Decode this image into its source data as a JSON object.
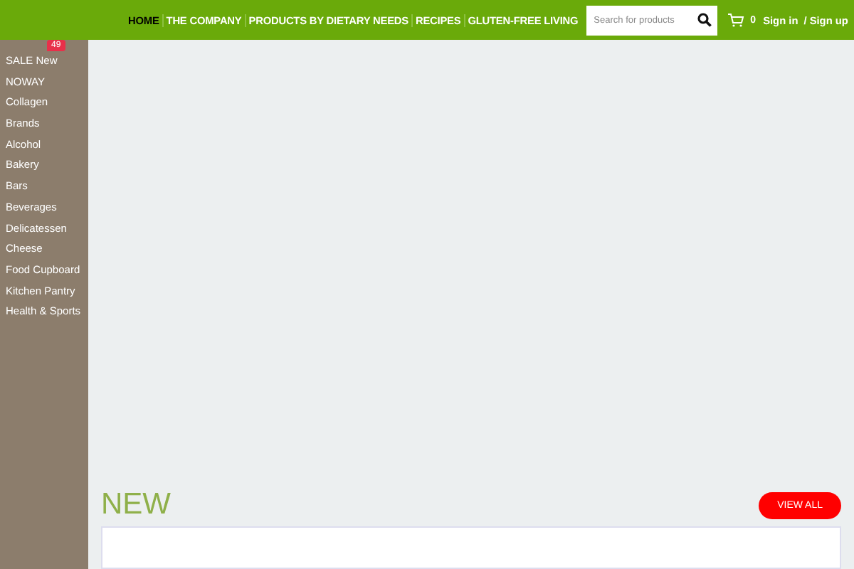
{
  "nav": [
    {
      "label": "HOME",
      "selected": true
    },
    {
      "label": "THE COMPANY",
      "selected": false
    },
    {
      "label": "PRODUCTS BY DIETARY NEEDS",
      "selected": false
    },
    {
      "label": "RECIPES",
      "selected": false
    },
    {
      "label": "GLUTEN-FREE LIVING",
      "selected": false
    }
  ],
  "search": {
    "placeholder": "Search for products"
  },
  "cart": {
    "count": "0"
  },
  "account": {
    "sign_in": "Sign in",
    "sign_up": "/ Sign up"
  },
  "sidebar": {
    "items": [
      {
        "label": "SALE New",
        "badge": "49"
      },
      {
        "label": "NOWAY"
      },
      {
        "label": "Collagen"
      },
      {
        "label": "Brands"
      },
      {
        "label": "Alcohol"
      },
      {
        "label": "Bakery"
      },
      {
        "label": "Bars"
      },
      {
        "label": "Beverages"
      },
      {
        "label": "Delicatessen"
      },
      {
        "label": "Cheese"
      },
      {
        "label": "Food Cupboard"
      },
      {
        "label": "Kitchen Pantry"
      },
      {
        "label": "Health & Sports"
      }
    ]
  },
  "section": {
    "title": "NEW",
    "button": "VIEW ALL"
  }
}
